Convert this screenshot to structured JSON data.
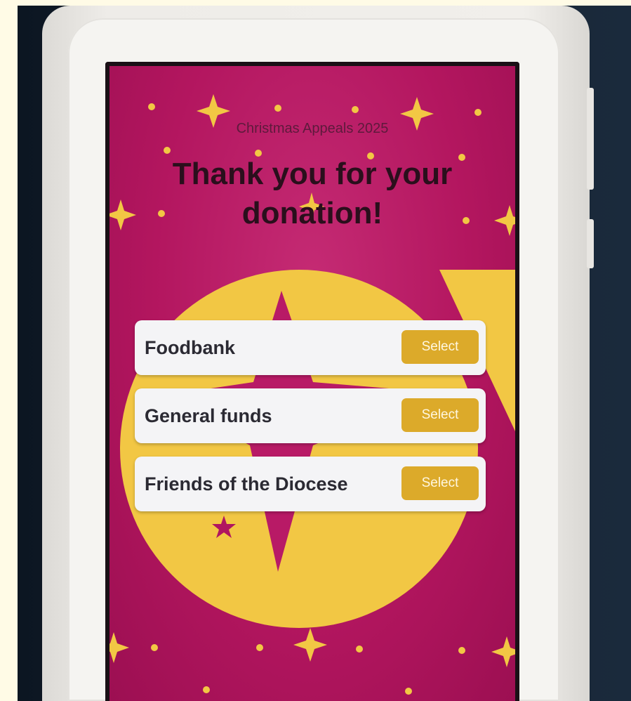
{
  "screen": {
    "appeal_title": "Christmas Appeals 2025",
    "headline_line1": "Thank you for your",
    "headline_line2": "donation!"
  },
  "options": [
    {
      "label": "Foodbank",
      "button": "Select"
    },
    {
      "label": "General funds",
      "button": "Select"
    },
    {
      "label": "Friends of the Diocese",
      "button": "Select"
    }
  ],
  "colors": {
    "background": "#b3165f",
    "accent_yellow": "#f2c744",
    "button": "#dcaa2a",
    "card": "#f4f4f6",
    "headline": "#2a0f1c"
  },
  "icons": [
    "star-icon",
    "sunburst-graphic"
  ]
}
